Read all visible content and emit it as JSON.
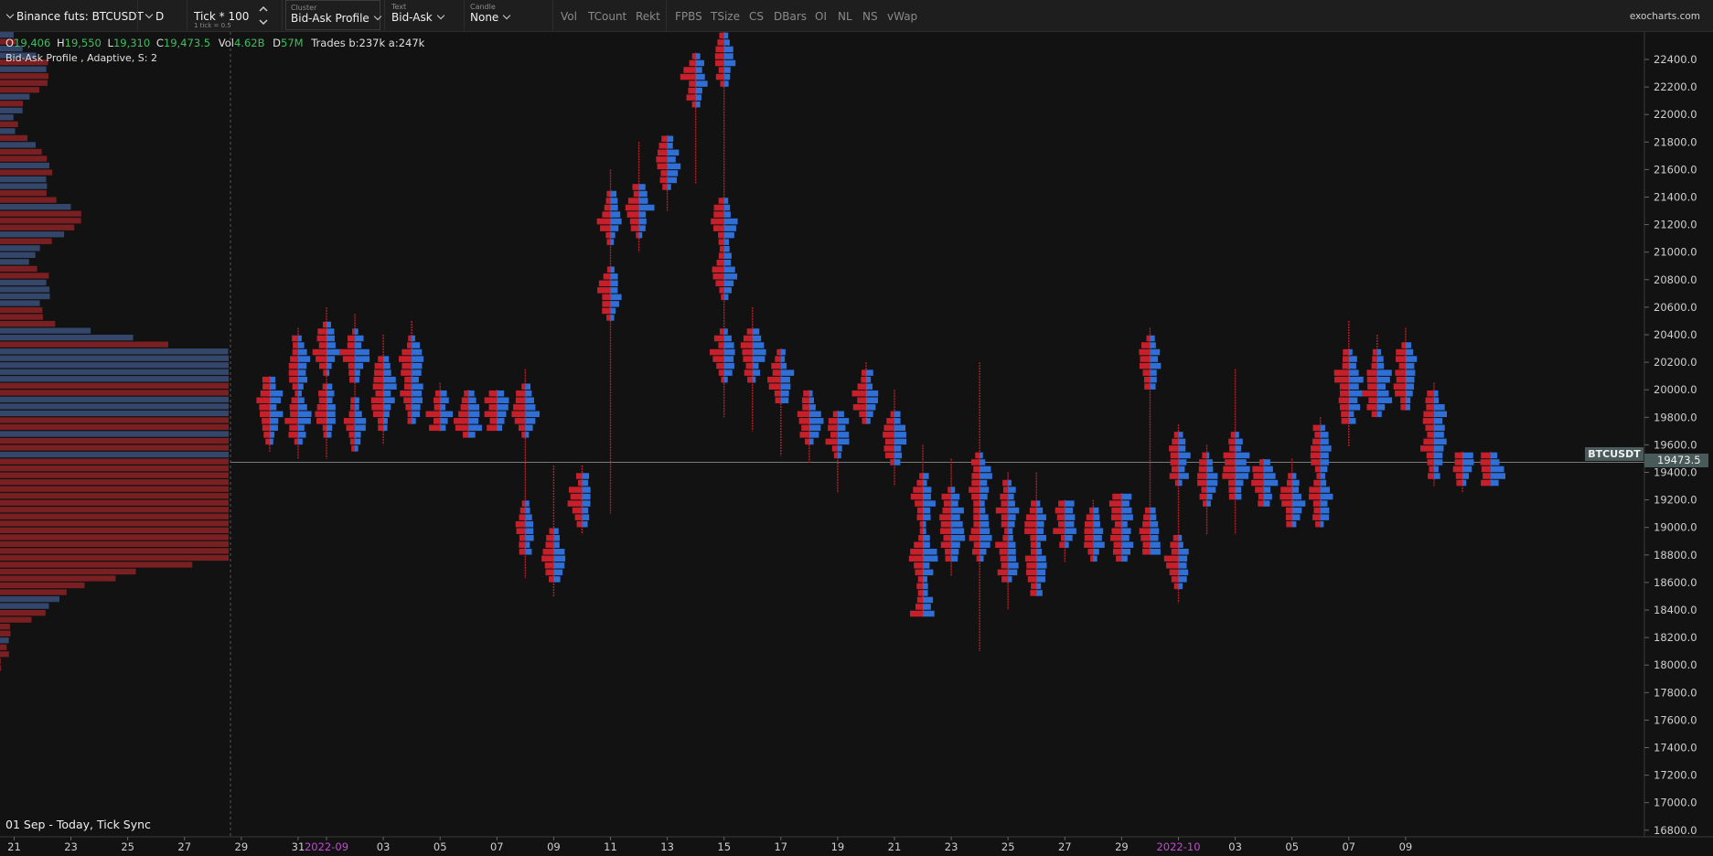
{
  "toolbar": {
    "symbol": "Binance futs: BTCUSDT",
    "timeframe": "D",
    "tick_main": "Tick * 100",
    "tick_sub": "1 tick = 0.5",
    "cluster_label": "Cluster",
    "cluster_value": "Bid-Ask Profile",
    "text_label": "Text",
    "text_value": "Bid-Ask",
    "candle_label": "Candle",
    "candle_value": "None",
    "buttons": [
      "Vol",
      "TCount",
      "Rekt",
      "FPBS",
      "TSize",
      "CS",
      "DBars",
      "OI",
      "NL",
      "NS",
      "vWap"
    ],
    "brand": "exocharts.com"
  },
  "stats": {
    "o_label": "O",
    "o_value": "19,406",
    "h_label": "H",
    "h_value": "19,550",
    "l_label": "L",
    "l_value": "19,310",
    "c_label": "C",
    "c_value": "19,473.5",
    "vol_label": "Vol",
    "vol_value": "4.62B",
    "d_label": "D",
    "d_value": "57M",
    "trades": "Trades b:237k a:247k"
  },
  "indicator_label": "Bid-Ask Profile , Adaptive, S: 2",
  "range_label": "01 Sep  - Today, Tick Sync",
  "price_tag": {
    "symbol": "BTCUSDT",
    "price": "19473.5"
  },
  "colors": {
    "bid": "#c8202a",
    "ask": "#2f6fd6",
    "profile_bid": "#7a1f22",
    "profile_ask": "#34466a",
    "background": "#121212",
    "price_label_bg": "#4a5a5a"
  },
  "chart_data": {
    "type": "bid-ask profile candles",
    "y_ticks": [
      "22400.0",
      "22200.0",
      "22000.0",
      "21800.0",
      "21600.0",
      "21400.0",
      "21200.0",
      "21000.0",
      "20800.0",
      "20600.0",
      "20400.0",
      "20200.0",
      "20000.0",
      "19800.0",
      "19600.0",
      "19400.0",
      "19200.0",
      "19000.0",
      "18800.0",
      "18600.0",
      "18400.0",
      "18200.0",
      "18000.0",
      "17800.0",
      "17600.0",
      "17400.0",
      "17200.0",
      "17000.0",
      "16800.0"
    ],
    "y_tick_values": [
      22400,
      22200,
      22000,
      21800,
      21600,
      21400,
      21200,
      21000,
      20800,
      20600,
      20400,
      20200,
      20000,
      19800,
      19600,
      19400,
      19200,
      19000,
      18800,
      18600,
      18400,
      18200,
      18000,
      17800,
      17600,
      17400,
      17200,
      17000,
      16800
    ],
    "x_ticks": [
      {
        "label": "21",
        "day": -11
      },
      {
        "label": "23",
        "day": -9
      },
      {
        "label": "25",
        "day": -7
      },
      {
        "label": "27",
        "day": -5
      },
      {
        "label": "29",
        "day": -3
      },
      {
        "label": "31",
        "day": -1
      },
      {
        "label": "2022-09",
        "day": 0,
        "highlight": true
      },
      {
        "label": "03",
        "day": 2
      },
      {
        "label": "05",
        "day": 4
      },
      {
        "label": "07",
        "day": 6
      },
      {
        "label": "09",
        "day": 8
      },
      {
        "label": "11",
        "day": 10
      },
      {
        "label": "13",
        "day": 12
      },
      {
        "label": "15",
        "day": 14
      },
      {
        "label": "17",
        "day": 16
      },
      {
        "label": "19",
        "day": 18
      },
      {
        "label": "21",
        "day": 20
      },
      {
        "label": "23",
        "day": 22
      },
      {
        "label": "25",
        "day": 24
      },
      {
        "label": "27",
        "day": 26
      },
      {
        "label": "29",
        "day": 28
      },
      {
        "label": "2022-10",
        "day": 30,
        "highlight": true
      },
      {
        "label": "03",
        "day": 32
      },
      {
        "label": "05",
        "day": 34
      },
      {
        "label": "07",
        "day": 36
      },
      {
        "label": "09",
        "day": 38
      }
    ],
    "current_price": 19473.5,
    "candles": [
      {
        "day": -2,
        "high": 20100,
        "low": 19550,
        "pocs": [
          19950,
          19800
        ]
      },
      {
        "day": -1,
        "high": 20450,
        "low": 19500,
        "pocs": [
          20200,
          19800
        ]
      },
      {
        "day": 0,
        "high": 20600,
        "low": 19500,
        "pocs": [
          20300,
          19850
        ]
      },
      {
        "day": 1,
        "high": 20550,
        "low": 19550,
        "pocs": [
          20250,
          19750
        ]
      },
      {
        "day": 2,
        "high": 20400,
        "low": 19600,
        "pocs": [
          20050,
          19900
        ]
      },
      {
        "day": 3,
        "high": 20500,
        "low": 19750,
        "pocs": [
          20200,
          19950
        ]
      },
      {
        "day": 4,
        "high": 20050,
        "low": 19700,
        "pocs": [
          19800
        ]
      },
      {
        "day": 5,
        "high": 20000,
        "low": 19650,
        "pocs": [
          19850,
          19750
        ]
      },
      {
        "day": 6,
        "high": 20000,
        "low": 19700,
        "pocs": [
          19850
        ]
      },
      {
        "day": 7,
        "high": 20150,
        "low": 18630,
        "pocs": [
          19850,
          19000
        ]
      },
      {
        "day": 8,
        "high": 19450,
        "low": 18500,
        "pocs": [
          18800
        ]
      },
      {
        "day": 9,
        "high": 19450,
        "low": 18950,
        "pocs": [
          19200
        ]
      },
      {
        "day": 10,
        "high": 21600,
        "low": 19100,
        "pocs": [
          21250,
          20700
        ]
      },
      {
        "day": 11,
        "high": 21800,
        "low": 21000,
        "pocs": [
          21300
        ]
      },
      {
        "day": 12,
        "high": 21850,
        "low": 21300,
        "pocs": [
          21650
        ]
      },
      {
        "day": 13,
        "high": 22450,
        "low": 21500,
        "pocs": [
          22250
        ]
      },
      {
        "day": 14,
        "high": 22800,
        "low": 19800,
        "pocs": [
          22400,
          21200,
          20850,
          20250
        ]
      },
      {
        "day": 15,
        "high": 20600,
        "low": 19700,
        "pocs": [
          20250
        ]
      },
      {
        "day": 16,
        "high": 20300,
        "low": 19520,
        "pocs": [
          20100
        ]
      },
      {
        "day": 17,
        "high": 20000,
        "low": 19470,
        "pocs": [
          19800
        ]
      },
      {
        "day": 18,
        "high": 19850,
        "low": 19250,
        "pocs": [
          19700
        ]
      },
      {
        "day": 19,
        "high": 20200,
        "low": 19750,
        "pocs": [
          19950
        ]
      },
      {
        "day": 20,
        "high": 20000,
        "low": 19300,
        "pocs": [
          19650
        ]
      },
      {
        "day": 21,
        "high": 19600,
        "low": 18350,
        "pocs": [
          19200,
          18800,
          18400
        ]
      },
      {
        "day": 22,
        "high": 19500,
        "low": 18650,
        "pocs": [
          19100,
          18950
        ]
      },
      {
        "day": 23,
        "high": 20200,
        "low": 18100,
        "pocs": [
          19350,
          18950
        ]
      },
      {
        "day": 24,
        "high": 19400,
        "low": 18400,
        "pocs": [
          19150,
          18800
        ]
      },
      {
        "day": 25,
        "high": 19400,
        "low": 18500,
        "pocs": [
          19000,
          18700
        ]
      },
      {
        "day": 26,
        "high": 19200,
        "low": 18750,
        "pocs": [
          19050
        ]
      },
      {
        "day": 27,
        "high": 19200,
        "low": 18750,
        "pocs": [
          18950
        ]
      },
      {
        "day": 28,
        "high": 19250,
        "low": 18750,
        "pocs": [
          19150,
          18900
        ]
      },
      {
        "day": 29,
        "high": 20450,
        "low": 18800,
        "pocs": [
          20200,
          18950
        ]
      },
      {
        "day": 30,
        "high": 19750,
        "low": 18450,
        "pocs": [
          19500,
          18750
        ]
      },
      {
        "day": 31,
        "high": 19600,
        "low": 18950,
        "pocs": [
          19350
        ]
      },
      {
        "day": 32,
        "high": 20150,
        "low": 18950,
        "pocs": [
          19500,
          19400
        ]
      },
      {
        "day": 33,
        "high": 19500,
        "low": 19150,
        "pocs": [
          19330
        ]
      },
      {
        "day": 34,
        "high": 19500,
        "low": 19000,
        "pocs": [
          19200
        ]
      },
      {
        "day": 35,
        "high": 19800,
        "low": 19000,
        "pocs": [
          19200,
          19550
        ]
      },
      {
        "day": 36,
        "high": 20500,
        "low": 19590,
        "pocs": [
          20100,
          19950
        ]
      },
      {
        "day": 37,
        "high": 20400,
        "low": 19800,
        "pocs": [
          20100,
          19950
        ]
      },
      {
        "day": 38,
        "high": 20450,
        "low": 19850,
        "pocs": [
          20150,
          20050
        ]
      },
      {
        "day": 39,
        "high": 20050,
        "low": 19300,
        "pocs": [
          19800,
          19550
        ]
      },
      {
        "day": 40,
        "high": 19550,
        "low": 19250,
        "pocs": [
          19480
        ]
      },
      {
        "day": 41,
        "high": 19550,
        "low": 19300,
        "pocs": [
          19406
        ]
      }
    ]
  }
}
